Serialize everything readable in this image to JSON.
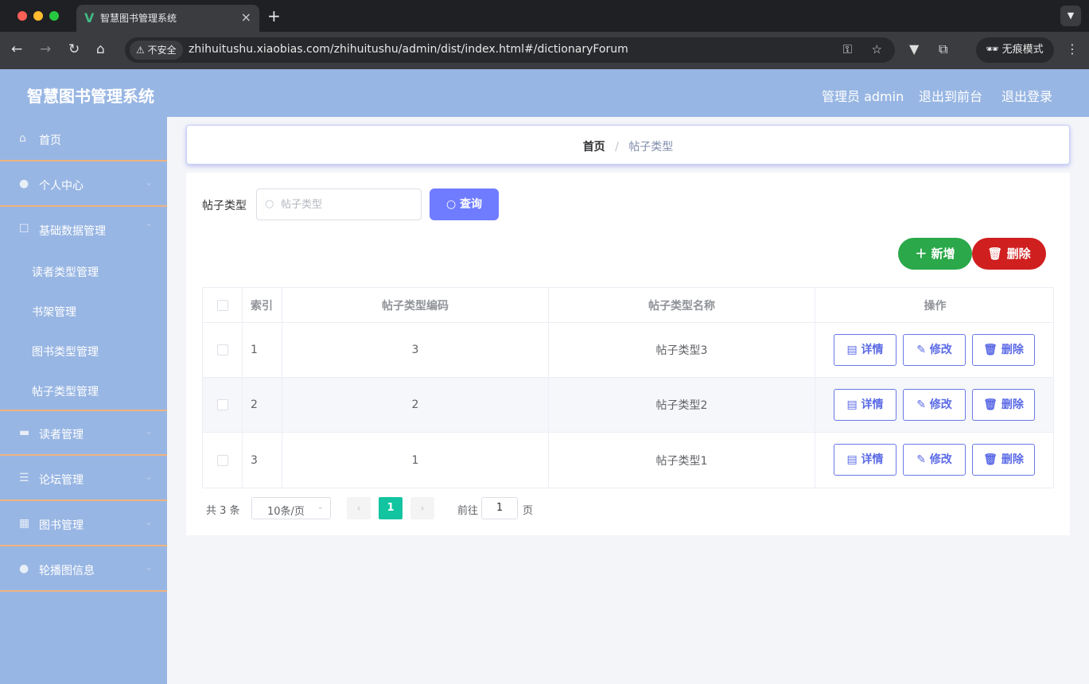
{
  "browser": {
    "tab_title": "智慧图书管理系统",
    "tab_favicon": "V",
    "insecure_label": "不安全",
    "url": "zhihuitushu.xiaobias.com/zhihuitushu/admin/dist/index.html#/dictionaryForum",
    "incognito_label": "无痕模式"
  },
  "header": {
    "title": "智慧图书管理系统",
    "admin_label": "管理员 admin",
    "to_front_label": "退出到前台",
    "logout_label": "退出登录"
  },
  "sidebar": {
    "items": [
      {
        "label": "首页",
        "icon": "home-icon",
        "has_submenu": false
      },
      {
        "label": "个人中心",
        "icon": "user-icon",
        "has_submenu": true
      },
      {
        "label": "基础数据管理",
        "icon": "chat-icon",
        "has_submenu": true,
        "expanded": true,
        "children": [
          "读者类型管理",
          "书架管理",
          "图书类型管理",
          "帖子类型管理"
        ]
      },
      {
        "label": "读者管理",
        "icon": "briefcase-icon",
        "has_submenu": true
      },
      {
        "label": "论坛管理",
        "icon": "list-icon",
        "has_submenu": true
      },
      {
        "label": "图书管理",
        "icon": "grid-icon",
        "has_submenu": true
      },
      {
        "label": "轮播图信息",
        "icon": "bulb-icon",
        "has_submenu": true
      }
    ]
  },
  "breadcrumb": {
    "home": "首页",
    "separator": "/",
    "current": "帖子类型"
  },
  "search": {
    "label": "帖子类型",
    "placeholder": "帖子类型",
    "value": "",
    "query_button": "查询"
  },
  "actions": {
    "add_label": "新增",
    "delete_label": "删除"
  },
  "table": {
    "columns": [
      "索引",
      "帖子类型编码",
      "帖子类型名称",
      "操作"
    ],
    "rows": [
      {
        "index": "1",
        "code": "3",
        "name": "帖子类型3"
      },
      {
        "index": "2",
        "code": "2",
        "name": "帖子类型2"
      },
      {
        "index": "3",
        "code": "1",
        "name": "帖子类型1"
      }
    ],
    "row_actions": {
      "detail": "详情",
      "edit": "修改",
      "delete": "删除"
    }
  },
  "pagination": {
    "total_label": "共 3 条",
    "page_size": "10条/页",
    "current_page": "1",
    "goto_label": "前往",
    "goto_value": "1",
    "goto_suffix": "页"
  },
  "colors": {
    "header_bg": "#98b6e3",
    "query_button": "#6f7cff",
    "add_button": "#2aa84a",
    "delete_button": "#d01f1f",
    "pagination_active": "#13c4a0",
    "menu_divider": "#f0b37e"
  }
}
